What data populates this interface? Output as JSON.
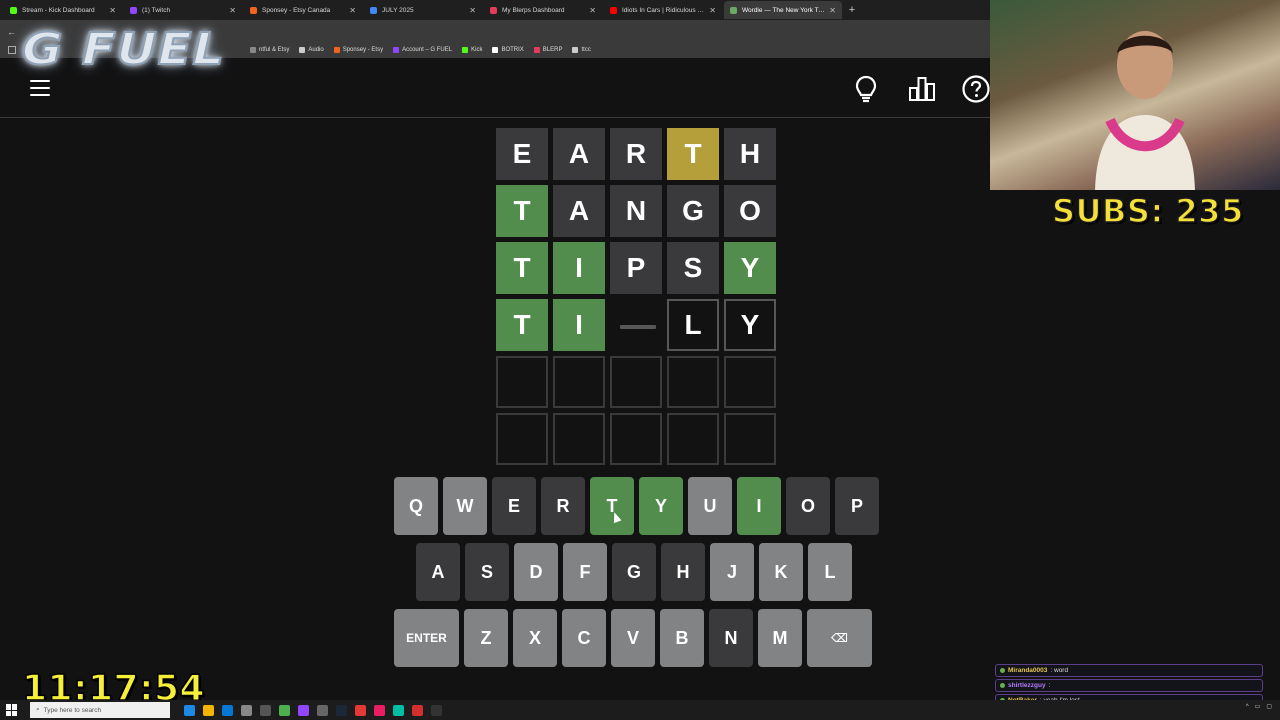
{
  "browser": {
    "tabs": [
      {
        "title": "Stream - Kick Dashboard",
        "color": "#53fc18"
      },
      {
        "title": "(1) Twitch",
        "color": "#9146ff"
      },
      {
        "title": "Sponsey - Etsy Canada",
        "color": "#f1641e"
      },
      {
        "title": "JULY 2025",
        "color": "#4285f4"
      },
      {
        "title": "My Blerps Dashboard",
        "color": "#e63a5a"
      },
      {
        "title": "Idiots In Cars | Ridiculous Drivi",
        "color": "#ff0000"
      },
      {
        "title": "Wordle — The New York Times",
        "color": "#6aaa64"
      }
    ],
    "bookmarks": [
      {
        "label": "ntful & Etsy",
        "color": "#888888"
      },
      {
        "label": "Audio",
        "color": "#cccccc"
      },
      {
        "label": "Sponsey - Etsy",
        "color": "#f1641e"
      },
      {
        "label": "Account – G FUEL",
        "color": "#9146ff"
      },
      {
        "label": "Kick",
        "color": "#53fc18"
      },
      {
        "label": "BOTRIX",
        "color": "#ffffff"
      },
      {
        "label": "BLERP",
        "color": "#e63a5a"
      },
      {
        "label": "ttcc",
        "color": "#cccccc"
      }
    ]
  },
  "overlay": {
    "brand": "G FUEL",
    "subs": "SUBS: 235",
    "clock": "11:17:54"
  },
  "board": [
    [
      {
        "l": "E",
        "s": "absent"
      },
      {
        "l": "A",
        "s": "absent"
      },
      {
        "l": "R",
        "s": "absent"
      },
      {
        "l": "T",
        "s": "present"
      },
      {
        "l": "H",
        "s": "absent"
      }
    ],
    [
      {
        "l": "T",
        "s": "correct"
      },
      {
        "l": "A",
        "s": "absent"
      },
      {
        "l": "N",
        "s": "absent"
      },
      {
        "l": "G",
        "s": "absent"
      },
      {
        "l": "O",
        "s": "absent"
      }
    ],
    [
      {
        "l": "T",
        "s": "correct"
      },
      {
        "l": "I",
        "s": "correct"
      },
      {
        "l": "P",
        "s": "absent"
      },
      {
        "l": "S",
        "s": "absent"
      },
      {
        "l": "Y",
        "s": "correct"
      }
    ],
    [
      {
        "l": "T",
        "s": "correct"
      },
      {
        "l": "I",
        "s": "correct"
      },
      {
        "l": "",
        "s": "cursor"
      },
      {
        "l": "L",
        "s": "tbd"
      },
      {
        "l": "Y",
        "s": "tbd"
      }
    ],
    [
      {
        "l": "",
        "s": "empty"
      },
      {
        "l": "",
        "s": "empty"
      },
      {
        "l": "",
        "s": "empty"
      },
      {
        "l": "",
        "s": "empty"
      },
      {
        "l": "",
        "s": "empty"
      }
    ],
    [
      {
        "l": "",
        "s": "empty"
      },
      {
        "l": "",
        "s": "empty"
      },
      {
        "l": "",
        "s": "empty"
      },
      {
        "l": "",
        "s": "empty"
      },
      {
        "l": "",
        "s": "empty"
      }
    ]
  ],
  "keyboard": [
    [
      {
        "k": "Q",
        "s": "unused"
      },
      {
        "k": "W",
        "s": "unused"
      },
      {
        "k": "E",
        "s": "absent"
      },
      {
        "k": "R",
        "s": "absent"
      },
      {
        "k": "T",
        "s": "correct"
      },
      {
        "k": "Y",
        "s": "correct"
      },
      {
        "k": "U",
        "s": "unused"
      },
      {
        "k": "I",
        "s": "correct"
      },
      {
        "k": "O",
        "s": "absent"
      },
      {
        "k": "P",
        "s": "absent"
      }
    ],
    [
      {
        "k": "A",
        "s": "absent"
      },
      {
        "k": "S",
        "s": "absent"
      },
      {
        "k": "D",
        "s": "unused"
      },
      {
        "k": "F",
        "s": "unused"
      },
      {
        "k": "G",
        "s": "absent"
      },
      {
        "k": "H",
        "s": "absent"
      },
      {
        "k": "J",
        "s": "unused"
      },
      {
        "k": "K",
        "s": "unused"
      },
      {
        "k": "L",
        "s": "unused"
      }
    ],
    [
      {
        "k": "ENTER",
        "s": "unused",
        "wide": true
      },
      {
        "k": "Z",
        "s": "unused"
      },
      {
        "k": "X",
        "s": "unused"
      },
      {
        "k": "C",
        "s": "unused"
      },
      {
        "k": "V",
        "s": "unused"
      },
      {
        "k": "B",
        "s": "unused"
      },
      {
        "k": "N",
        "s": "absent"
      },
      {
        "k": "M",
        "s": "unused"
      },
      {
        "k": "⌫",
        "s": "unused",
        "wide": true
      }
    ]
  ],
  "chat": [
    {
      "user": "Miranda0003",
      "msg": " : word",
      "color": "#e8c84a"
    },
    {
      "user": "shirtlezzguy",
      "msg": " :",
      "color": "#b57cff"
    },
    {
      "user": "NotBaker",
      "msg": " : yeah I'm lost",
      "color": "#e8c84a"
    }
  ],
  "taskbar": {
    "search_placeholder": "Type here to search"
  },
  "colors": {
    "correct": "#538d4e",
    "present": "#b59f3b",
    "absent": "#3a3a3c",
    "unused_key": "#818384",
    "background": "#121213"
  }
}
